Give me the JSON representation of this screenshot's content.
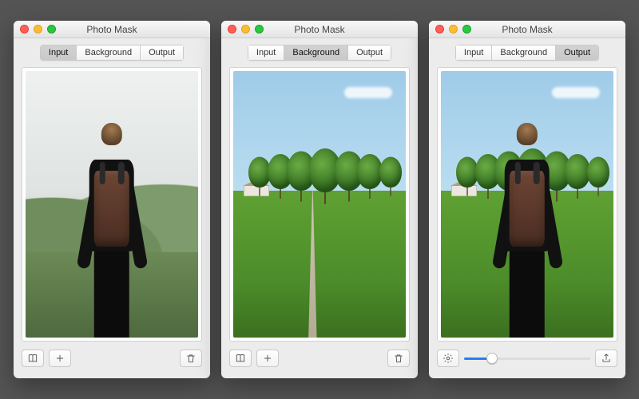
{
  "app_title": "Photo Mask",
  "tabs": {
    "input": "Input",
    "background": "Background",
    "output": "Output"
  },
  "windows": [
    {
      "active_tab": "input",
      "toolbar": {
        "type": "library",
        "buttons": [
          "library",
          "add",
          "trash"
        ]
      }
    },
    {
      "active_tab": "background",
      "toolbar": {
        "type": "library",
        "buttons": [
          "library",
          "add",
          "trash"
        ]
      }
    },
    {
      "active_tab": "output",
      "toolbar": {
        "type": "slider",
        "buttons": [
          "settings",
          "share"
        ],
        "slider": {
          "min": 0,
          "max": 100,
          "value": 22
        }
      }
    }
  ],
  "colors": {
    "accent": "#2a7bf6"
  }
}
